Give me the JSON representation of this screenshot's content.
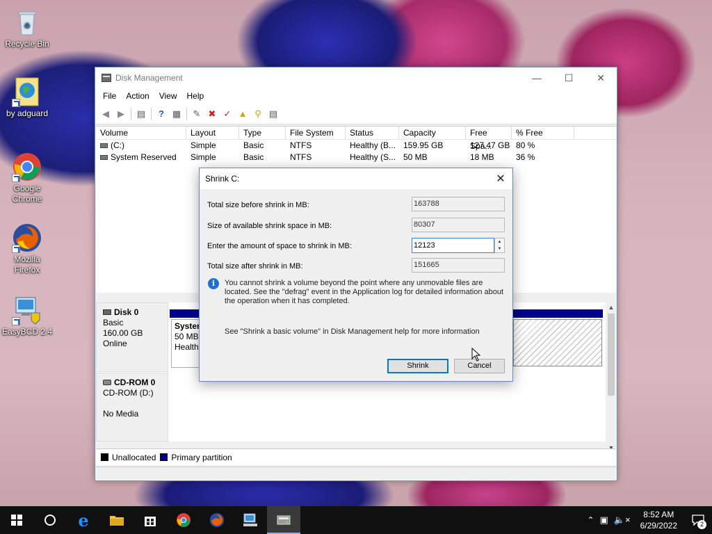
{
  "desktop": {
    "icons": [
      {
        "label": "Recycle Bin",
        "icon": "recycle-bin-icon"
      },
      {
        "label": "by adguard",
        "icon": "globe-document-icon"
      },
      {
        "label": "Google Chrome",
        "icon": "chrome-icon"
      },
      {
        "label": "Mozilla Firefox",
        "icon": "firefox-icon"
      },
      {
        "label": "EasyBCD 2.4",
        "icon": "easybcd-icon"
      }
    ]
  },
  "window": {
    "title": "Disk Management",
    "menu": [
      "File",
      "Action",
      "View",
      "Help"
    ],
    "columns": [
      "Volume",
      "Layout",
      "Type",
      "File System",
      "Status",
      "Capacity",
      "Free Spa...",
      "% Free"
    ],
    "volumes": [
      {
        "volume": "(C:)",
        "layout": "Simple",
        "type": "Basic",
        "fs": "NTFS",
        "status": "Healthy (B...",
        "capacity": "159.95 GB",
        "free": "127.47 GB",
        "pct": "80 %"
      },
      {
        "volume": "System Reserved",
        "layout": "Simple",
        "type": "Basic",
        "fs": "NTFS",
        "status": "Healthy (S...",
        "capacity": "50 MB",
        "free": "18 MB",
        "pct": "36 %"
      }
    ],
    "disk0": {
      "name": "Disk 0",
      "type": "Basic",
      "size": "160.00 GB",
      "state": "Online"
    },
    "partition_sys": {
      "name": "System",
      "size": "50 MB",
      "status": "Healthy"
    },
    "cdrom": {
      "name": "CD-ROM 0",
      "drive": "CD-ROM (D:)",
      "media": "No Media"
    },
    "legend": {
      "unallocated": "Unallocated",
      "primary": "Primary partition"
    },
    "colors": {
      "primary": "#00008b",
      "unallocated": "#000000"
    }
  },
  "dialog": {
    "title": "Shrink C:",
    "total_before_label": "Total size before shrink in MB:",
    "total_before": "163788",
    "available_label": "Size of available shrink space in MB:",
    "available": "80307",
    "amount_label": "Enter the amount of space to shrink in MB:",
    "amount": "12123",
    "total_after_label": "Total size after shrink in MB:",
    "total_after": "151665",
    "info": "You cannot shrink a volume beyond the point where any unmovable files are located. See the \"defrag\" event in the Application log for detailed information about the operation when it has completed.",
    "help": "See \"Shrink a basic volume\" in Disk Management help for more information",
    "shrink_btn": "Shrink",
    "cancel_btn": "Cancel"
  },
  "taskbar": {
    "time": "8:52 AM",
    "date": "6/29/2022",
    "notification_count": "2"
  }
}
